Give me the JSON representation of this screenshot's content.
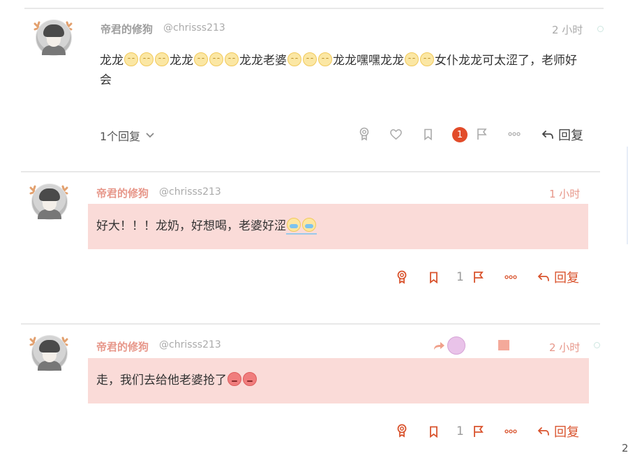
{
  "post1": {
    "username": "帝君的修狗",
    "handle": "@chrisss213",
    "time": "2 小时",
    "text_parts": [
      "龙龙",
      "龙龙",
      "龙龙老婆",
      "龙龙嘿嘿龙龙",
      "女仆龙龙可太涩了，老师好",
      "会"
    ],
    "replies_label": "1个回复",
    "badge_count": "1",
    "reply_label": "回复"
  },
  "post2": {
    "username": "帝君的修狗",
    "handle": "@chrisss213",
    "time": "1 小时",
    "text": "好大！！！龙奶，好想喝，老婆好涩",
    "count": "1",
    "reply_label": "回复"
  },
  "post3": {
    "username": "帝君的修狗",
    "handle": "@chrisss213",
    "time": "2 小时",
    "text": "走，我们去给他老婆抢了",
    "count": "1",
    "reply_label": "回复"
  },
  "page_number": "2",
  "colors": {
    "accent": "#d9532d",
    "pink_bg": "#fadbd8",
    "username_accent": "#e7978a",
    "username_gray": "#9e9e9e",
    "icon_gray": "#aaaaaa"
  }
}
